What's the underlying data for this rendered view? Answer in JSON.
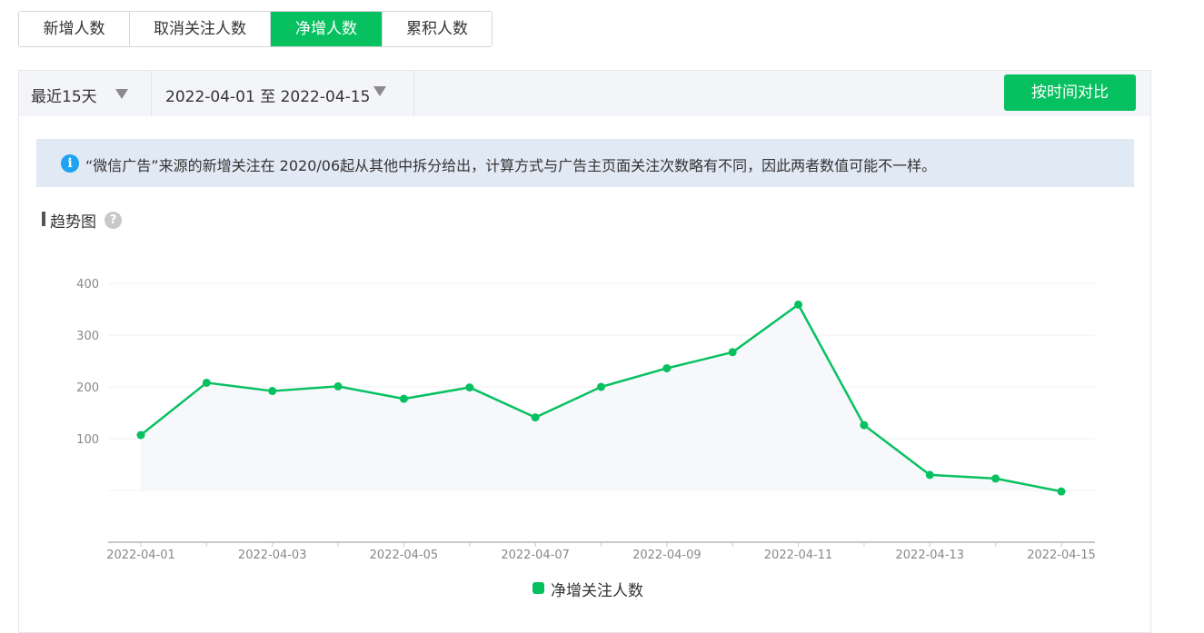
{
  "tabs": [
    {
      "label": "新增人数",
      "active": false
    },
    {
      "label": "取消关注人数",
      "active": false
    },
    {
      "label": "净增人数",
      "active": true
    },
    {
      "label": "累积人数",
      "active": false
    }
  ],
  "filters": {
    "range_label": "最近15天",
    "date_range": "2022-04-01 至 2022-04-15",
    "compare_button": "按时间对比"
  },
  "notice": {
    "icon": "info-icon",
    "text": "“微信广告”来源的新增关注在 2020/06起从其他中拆分给出，计算方式与广告主页面关注次数略有不同，因此两者数值可能不一样。"
  },
  "chart_heading": {
    "title": "趋势图",
    "help_icon": "question-icon",
    "help_glyph": "?"
  },
  "colors": {
    "accent": "#07c160",
    "notice_bg": "#e1e9f5",
    "filter_bg": "#f4f5f9"
  },
  "chart_data": {
    "type": "line",
    "title": "",
    "xlabel": "",
    "ylabel": "",
    "x": [
      "2022-04-01",
      "2022-04-02",
      "2022-04-03",
      "2022-04-04",
      "2022-04-05",
      "2022-04-06",
      "2022-04-07",
      "2022-04-08",
      "2022-04-09",
      "2022-04-10",
      "2022-04-11",
      "2022-04-12",
      "2022-04-13",
      "2022-04-14",
      "2022-04-15"
    ],
    "x_tick_labels": [
      "2022-04-01",
      "2022-04-03",
      "2022-04-05",
      "2022-04-07",
      "2022-04-09",
      "2022-04-11",
      "2022-04-13",
      "2022-04-15"
    ],
    "y_ticks": [
      100,
      200,
      300,
      400
    ],
    "ylim": [
      -100,
      400
    ],
    "grid": true,
    "legend_position": "bottom-center",
    "series": [
      {
        "name": "净增关注人数",
        "color": "#07c160",
        "values": [
          107,
          208,
          192,
          201,
          177,
          199,
          141,
          200,
          236,
          267,
          359,
          126,
          30,
          23,
          -2
        ]
      }
    ]
  }
}
